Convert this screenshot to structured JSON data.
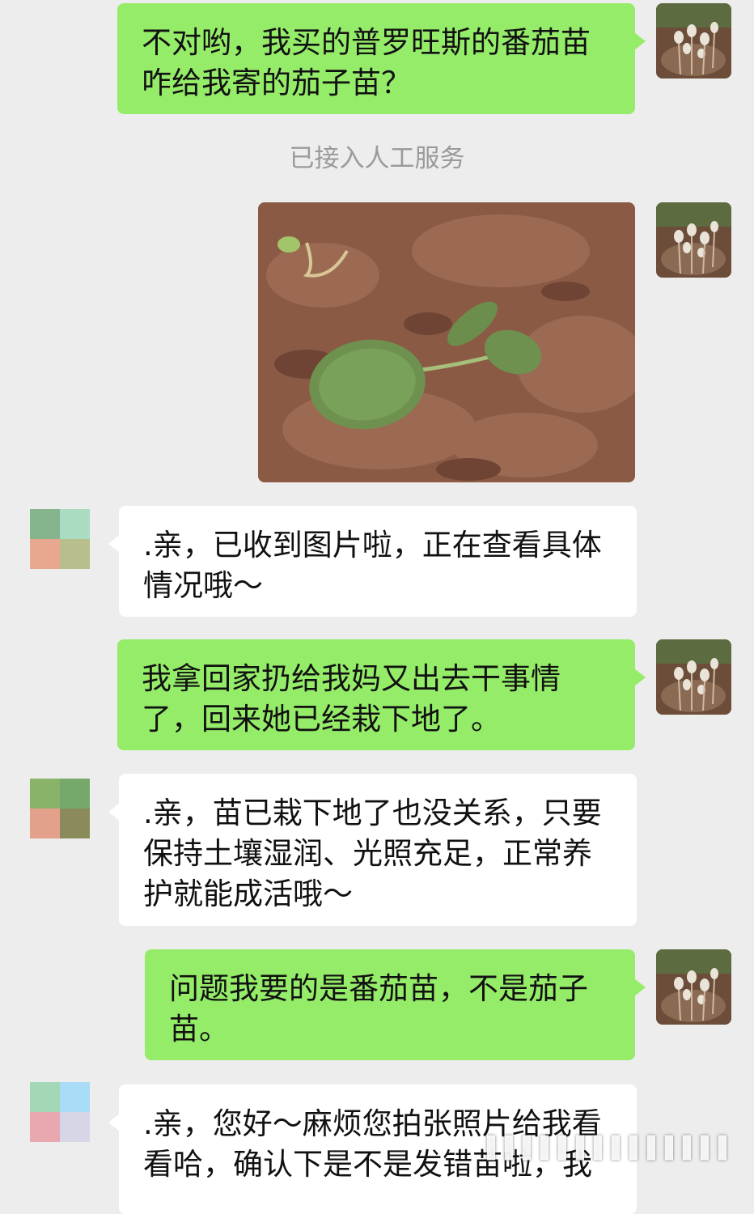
{
  "messages": [
    {
      "from": "me",
      "text": "不对哟，我买的普罗旺斯的番茄苗咋给我寄的茄子苗？"
    },
    {
      "system": "已接入人工服务"
    },
    {
      "from": "me",
      "type": "image",
      "image_desc": "seedling-photo"
    },
    {
      "from": "them",
      "text": ".亲，已收到图片啦，正在查看具体情况哦～"
    },
    {
      "from": "me",
      "text": "我拿回家扔给我妈又出去干事情了，回来她已经栽下地了。"
    },
    {
      "from": "them",
      "text": ".亲，苗已栽下地了也没关系，只要保持土壤湿润、光照充足，正常养护就能成活哦～"
    },
    {
      "from": "me",
      "text": "问题我要的是番茄苗，不是茄子苗。"
    },
    {
      "from": "them",
      "text": ".亲，您好～麻烦您拍张照片给我看看哈，确认下是不是发错苗啦，我"
    }
  ],
  "colors": {
    "background": "#ededed",
    "my_bubble": "#95ec69",
    "their_bubble": "#ffffff",
    "system_text": "#9a9a9a"
  },
  "icons": [
    "user-avatar-icon",
    "agent-avatar-icon",
    "watermark-icon"
  ]
}
